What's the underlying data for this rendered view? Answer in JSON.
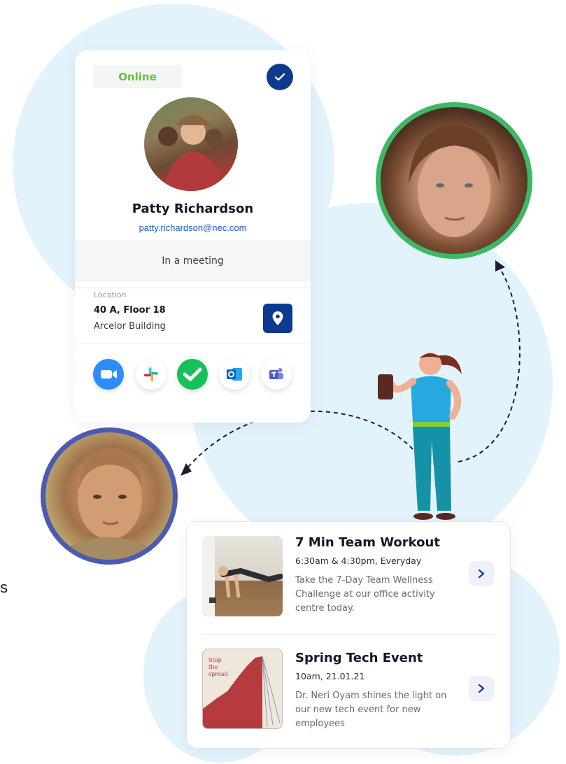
{
  "profile": {
    "status_badge": "Online",
    "name": "Patty Richardson",
    "email": "patty.richardson@nec.com",
    "presence": "In a meeting",
    "location": {
      "caption": "Location",
      "line1": "40 A,  Floor 18",
      "line2": "Arcelor Building"
    },
    "apps": [
      "zoom-icon",
      "slack-icon",
      "wrike-icon",
      "outlook-icon",
      "teams-icon"
    ]
  },
  "events": [
    {
      "title": "7 Min Team Workout",
      "time": "6:30am & 4:30pm, Everyday",
      "description": "Take the 7-Day Team Wellness Challenge at our office activity centre today."
    },
    {
      "title": "Spring Tech Event",
      "time": "10am, 21.01.21",
      "description": "Dr. Neri Oyam shines the light on our new tech event for new employees"
    }
  ],
  "side_text": "s",
  "colors": {
    "online": "#6dc03a",
    "primary": "#0d3a8f",
    "link": "#1a56c7",
    "ring_green": "#3fb865",
    "ring_indigo": "#4a5bb0",
    "background_blob": "#e3f3fc"
  }
}
